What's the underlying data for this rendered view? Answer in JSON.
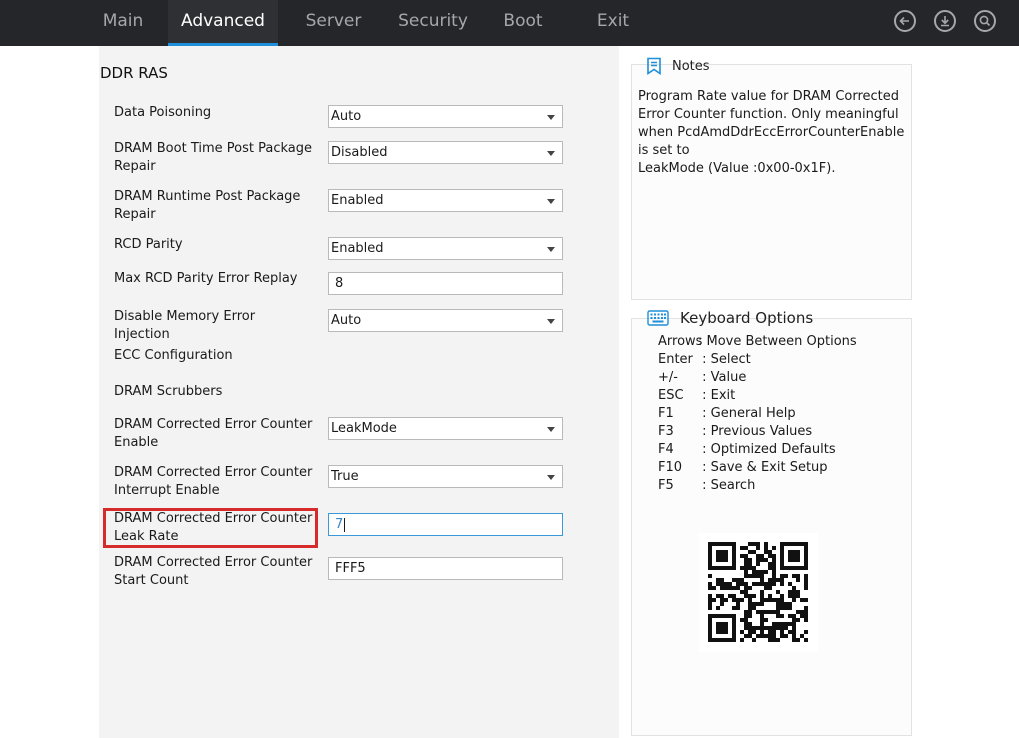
{
  "nav": {
    "tabs": [
      "Main",
      "Advanced",
      "Server",
      "Security",
      "Boot",
      "Exit"
    ],
    "active": "Advanced",
    "icons": [
      "back-icon",
      "download-icon",
      "search-icon"
    ]
  },
  "page": {
    "title": "DDR RAS",
    "settings": [
      {
        "label": "Data Poisoning",
        "value": "Auto"
      },
      {
        "label": "DRAM Boot Time Post Package Repair",
        "value": "Disabled"
      },
      {
        "label": "DRAM Runtime Post Package Repair",
        "value": "Enabled"
      },
      {
        "label": "RCD Parity",
        "value": "Enabled"
      },
      {
        "label": "Max RCD Parity Error Replay",
        "value": "8"
      },
      {
        "label": "Disable Memory Error Injection",
        "value": "Auto"
      },
      {
        "label": "ECC Configuration"
      },
      {
        "label": "DRAM Scrubbers"
      },
      {
        "label": "DRAM Corrected Error Counter Enable",
        "value": "LeakMode"
      },
      {
        "label": "DRAM Corrected Error Counter Interrupt Enable",
        "value": "True"
      },
      {
        "label": "DRAM Corrected Error Counter Leak Rate",
        "value": "7"
      },
      {
        "label": "DRAM Corrected Error Counter Start Count",
        "value": "FFF5"
      }
    ]
  },
  "notes": {
    "title": "Notes",
    "text": "Program Rate value for DRAM Corrected Error Counter function. Only meaningful when PcdAmdDdrEccErrorCounterEnable is set to",
    "text2": "LeakMode (Value :0x00-0x1F)."
  },
  "keyboard": {
    "title": "Keyboard Options",
    "items": [
      {
        "key": "Arrows",
        "desc": ": Move Between Options"
      },
      {
        "key": "Enter",
        "desc": " : Select"
      },
      {
        "key": "+/-",
        "desc": "  : Value"
      },
      {
        "key": "ESC",
        "desc": "  : Exit"
      },
      {
        "key": "F1",
        "desc": "  : General Help"
      },
      {
        "key": "F3",
        "desc": "  : Previous Values"
      },
      {
        "key": "F4",
        "desc": "  : Optimized Defaults"
      },
      {
        "key": "F10",
        "desc": "  : Save & Exit Setup"
      },
      {
        "key": "F5",
        "desc": "  : Search"
      }
    ]
  },
  "colors": {
    "accent": "#1e8fd8",
    "highlight": "#d62b2b",
    "nav_bg": "#25262a"
  }
}
